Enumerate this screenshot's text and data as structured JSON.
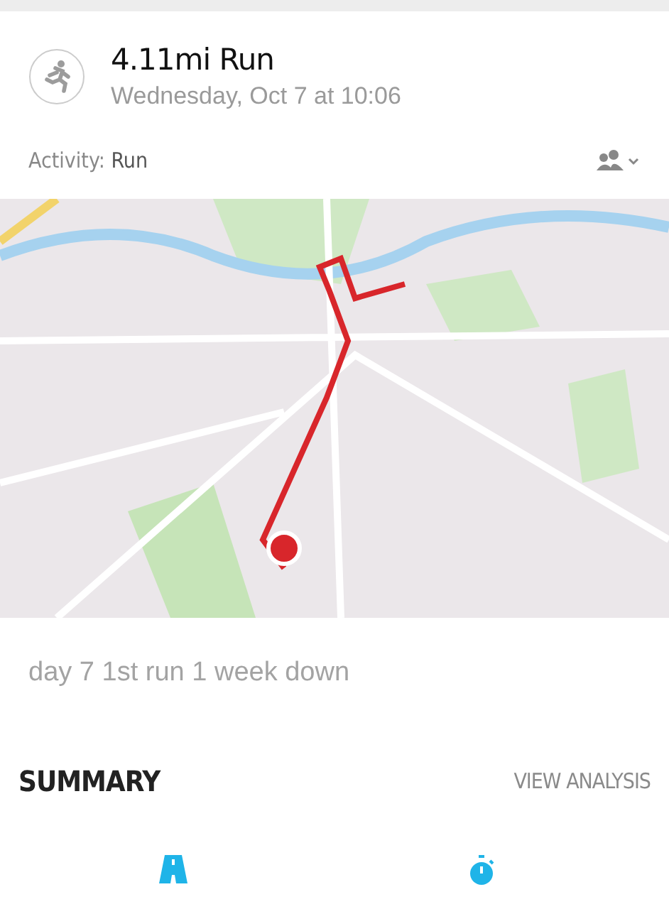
{
  "header": {
    "title": "4.11mi Run",
    "subtitle": "Wednesday, Oct 7 at 10:06"
  },
  "activity": {
    "label": "Activity:",
    "value": "Run"
  },
  "notes": "day 7 1st run 1 week down",
  "summary": {
    "heading": "SUMMARY",
    "action": "VIEW ANALYSIS",
    "stats": [
      {
        "kind": "distance"
      },
      {
        "kind": "duration"
      }
    ]
  }
}
